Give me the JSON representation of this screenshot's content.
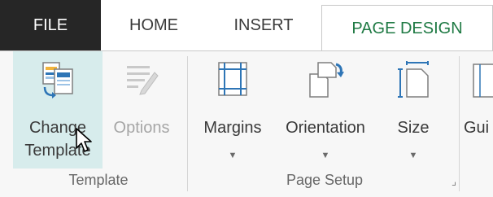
{
  "tabs": {
    "file": "FILE",
    "home": "HOME",
    "insert": "INSERT",
    "page_design": "PAGE DESIGN"
  },
  "groups": {
    "template": {
      "label": "Template",
      "change_template": {
        "line1": "Change",
        "line2": "Template",
        "icon": "change-template-icon"
      },
      "options": {
        "label": "Options",
        "icon": "options-icon",
        "disabled": true
      }
    },
    "page_setup": {
      "label": "Page Setup",
      "margins": {
        "label": "Margins",
        "icon": "margins-icon"
      },
      "orientation": {
        "label": "Orientation",
        "icon": "orientation-icon"
      },
      "size": {
        "label": "Size",
        "icon": "size-icon"
      },
      "guides": {
        "label": "Gui",
        "icon": "guides-icon"
      }
    }
  },
  "colors": {
    "active_tab_text": "#1f7a44",
    "file_tab_bg": "#262626",
    "hover_bg": "#d7ecec",
    "icon_blue": "#2e75b6"
  }
}
